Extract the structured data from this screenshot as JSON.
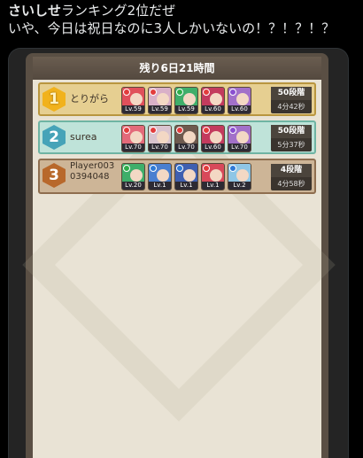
{
  "tweet": {
    "author": "さいしせ",
    "line1_rest": "ランキング2位だぜ",
    "line2": "いや、今日は祝日なのに3人しかいないの！？！？！？"
  },
  "game": {
    "remaining": "残り6日21時間",
    "rows": [
      {
        "rank": "1",
        "name": "とりがら",
        "stage": "50段階",
        "time": "4分42秒",
        "chars": [
          {
            "level": "Lv.59",
            "color": "#e0505b",
            "elem": "#e23c3c"
          },
          {
            "level": "Lv.59",
            "color": "#d9b0c8",
            "elem": "#e23c3c"
          },
          {
            "level": "Lv.59",
            "color": "#3fae6a",
            "elem": "#2fae4a"
          },
          {
            "level": "Lv.60",
            "color": "#c33b5e",
            "elem": "#e23c3c"
          },
          {
            "level": "Lv.60",
            "color": "#a270c9",
            "elem": "#8a4fd0"
          }
        ]
      },
      {
        "rank": "2",
        "name": "surea",
        "stage": "50段階",
        "time": "5分37秒",
        "chars": [
          {
            "level": "Lv.70",
            "color": "#e36a7a",
            "elem": "#e23c3c"
          },
          {
            "level": "Lv.70",
            "color": "#d9c4cf",
            "elem": "#e23c3c"
          },
          {
            "level": "Lv.70",
            "color": "#6e5a4f",
            "elem": "#e23c3c"
          },
          {
            "level": "Lv.60",
            "color": "#c33b5e",
            "elem": "#e23c3c"
          },
          {
            "level": "Lv.70",
            "color": "#a270c9",
            "elem": "#8a4fd0"
          }
        ]
      },
      {
        "rank": "3",
        "name": "Player0030394048",
        "stage": "4段階",
        "time": "4分58秒",
        "chars": [
          {
            "level": "Lv.20",
            "color": "#3fae6a",
            "elem": "#2fae4a"
          },
          {
            "level": "Lv.1",
            "color": "#4a7fd0",
            "elem": "#2f7ad6"
          },
          {
            "level": "Lv.1",
            "color": "#3f5fb0",
            "elem": "#2f7ad6"
          },
          {
            "level": "Lv.1",
            "color": "#d8495a",
            "elem": "#e23c3c"
          },
          {
            "level": "Lv.2",
            "color": "#8fc6e6",
            "elem": "#2f7ad6"
          }
        ]
      }
    ]
  }
}
